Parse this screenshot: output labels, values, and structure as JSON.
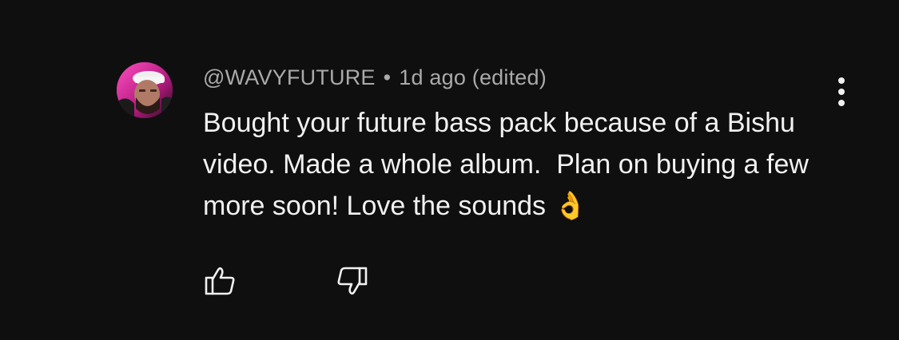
{
  "comment": {
    "author": "@WAVYFUTURE",
    "separator": "•",
    "time": "1d ago (edited)",
    "text": "Bought your future bass pack because of a Bishu video. Made a whole album.  Plan on buying a few more soon! Love the sounds 👌",
    "avatar_icon": "user-avatar",
    "menu_icon": "more-vertical-icon",
    "like_icon": "thumbs-up-icon",
    "dislike_icon": "thumbs-down-icon"
  },
  "colors": {
    "background": "#0f0f0f",
    "text_primary": "#f1f1f1",
    "text_secondary": "#aaaaaa",
    "avatar_accent": "#ff3fb4"
  }
}
